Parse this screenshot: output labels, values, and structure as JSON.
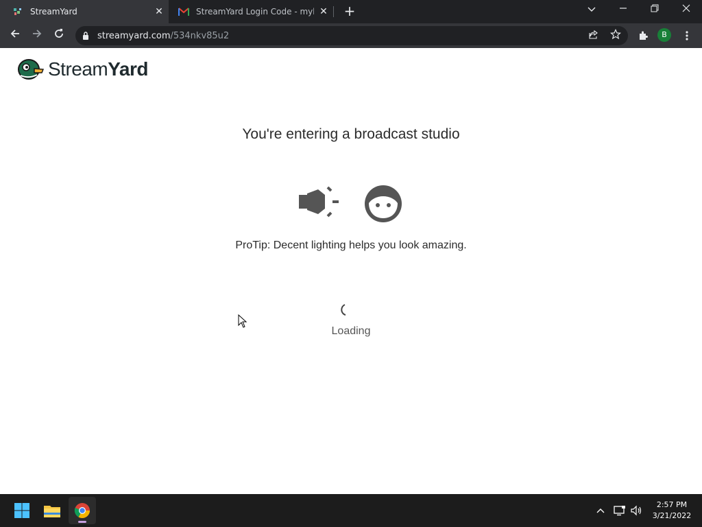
{
  "browser": {
    "tabs": [
      {
        "title": "StreamYard",
        "active": true,
        "favicon": "streamyard-favicon"
      },
      {
        "title": "StreamYard Login Code - myblue",
        "active": false,
        "favicon": "gmail-favicon"
      }
    ],
    "address": {
      "host": "streamyard.com",
      "path": "/534nkv85u2"
    },
    "profile_initial": "B"
  },
  "page": {
    "logo_text_light": "Stream",
    "logo_text_bold": "Yard",
    "heading": "You're entering a broadcast studio",
    "protip": "ProTip: Decent lighting helps you look amazing.",
    "loading": "Loading"
  },
  "taskbar": {
    "time": "2:57 PM",
    "date": "3/21/2022"
  },
  "colors": {
    "tabbar": "#202124",
    "toolbar": "#35363a",
    "icon_gray": "#555555",
    "taskbar": "#1c1c1c"
  }
}
